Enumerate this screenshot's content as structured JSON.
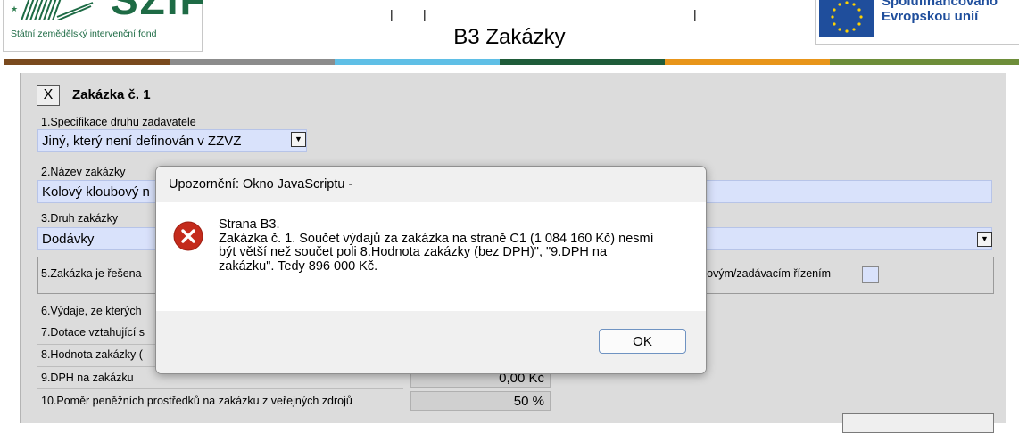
{
  "header": {
    "logo_text": "SZIF",
    "logo_subtitle": "Státní zemědělský intervenční fond",
    "page_title": "B3 Zakázky",
    "eu_line1": "Spolufinancováno",
    "eu_line2": "Evropskou unií"
  },
  "stripe_colors": [
    "#7a4a1e",
    "#8c8c8c",
    "#5fbfe6",
    "#1f5c3a",
    "#e8951a",
    "#6e8e3a"
  ],
  "form": {
    "close_label": "X",
    "zakazka_title": "Zakázka č. 1",
    "f1_label": "1.Specifikace druhu zadavatele",
    "f1_value": "Jiný, který není definován v ZZVZ",
    "f2_label": "2.Název zakázky",
    "f2_value": "Kolový kloubový n",
    "f3_label": "3.Druh zakázky",
    "f3_value": "Dodávky",
    "f5_label": "5.Zakázka je řešena",
    "f5_right_label": "běrovým/zadávacím řízením",
    "f6_label": "6.Výdaje, ze kterých",
    "f7_label": "7.Dotace vztahující s",
    "f8_label": "8.Hodnota zakázky (",
    "f9_label": "9.DPH na zakázku",
    "f9_value": "0,00 Kč",
    "f10_label": "10.Poměr peněžních prostředků na zakázku z veřejných zdrojů",
    "f10_value": "50 %"
  },
  "dialog": {
    "title": "Upozornění: Okno JavaScriptu -",
    "message": "Strana B3.\nZakázka č. 1. Součet výdajů za zakázka na straně C1 (1 084 160 Kč) nesmí\nbýt větší než součet poli 8.Hodnota zakázky (bez DPH)\", \"9.DPH na\nzakázku\". Tedy 896 000 Kč.",
    "ok_label": "OK",
    "icon": "error-icon"
  }
}
